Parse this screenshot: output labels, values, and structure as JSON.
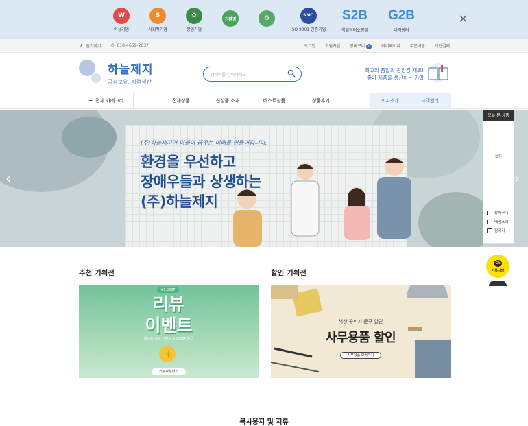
{
  "certs": [
    {
      "caption": "여성기업",
      "color": "#e04a4a",
      "glyph": "W"
    },
    {
      "caption": "사회적기업",
      "color": "#f08b2c",
      "glyph": "S"
    },
    {
      "caption": "창업기업",
      "color": "#3c8a4a",
      "glyph": "✿"
    },
    {
      "caption": "",
      "color": "#49a45a",
      "glyph": "친환경"
    },
    {
      "caption": "",
      "color": "#58a86a",
      "glyph": "♻"
    },
    {
      "caption": "ISO 9001 인증기업",
      "color": "#2b4f9e",
      "glyph": "SMC"
    },
    {
      "caption": "학교장터쇼핑몰",
      "big": "S2B"
    },
    {
      "caption": "나라장터",
      "big": "G2B"
    }
  ],
  "util": {
    "bookmark": "즐겨찾기",
    "phone": "010-4669-2637",
    "links": [
      "로그인",
      "회원가입",
      "장바구니",
      "마이페이지",
      "주문배송",
      "개인결제"
    ],
    "cart_count": "0"
  },
  "header": {
    "brand": "하늘제지",
    "tagline": "공장보유, 직접생산",
    "search_placeholder": "검색어를 입력하세요",
    "slogan_line1": "최고의 품질과 친환경 재료!",
    "slogan_line2": "좋이 제품을 생산하는 기업"
  },
  "nav": {
    "all_categories": "전체 카테고리",
    "menu": [
      "전체상품",
      "신상품 소개",
      "베스트상품",
      "상품후기"
    ],
    "cs": [
      "회사소개",
      "고객센터"
    ]
  },
  "hero": {
    "sub": "(주)하늘제지가 더불어 꿈꾸는 미래를 만들어갑니다.",
    "line1": "환경을 우선하고",
    "line2": "장애우들과 상생하는",
    "line3": "(주)하늘제지"
  },
  "side": {
    "head": "오늘 본 상품",
    "empty": "없음",
    "items": [
      "장바구니",
      "배송조회",
      "찜하기"
    ]
  },
  "kakao": {
    "label": "카톡상담",
    "glyph": "Ch"
  },
  "sections": {
    "recommend_title": "추천 기획전",
    "sale_title": "할인 기획전"
  },
  "review_card": {
    "pill": "+5,000P",
    "line1": "리뷰",
    "line2": "이벤트",
    "small": "베스트 리뷰 선정시 +5000P 지급",
    "button": "리뷰작성하기"
  },
  "sale_card": {
    "tag": "책상 꾸미기 문구 할인",
    "big": "사무용품 할인",
    "button": "사무용품 보러가기"
  },
  "bottom": {
    "title": "복사용지 및 지류"
  }
}
